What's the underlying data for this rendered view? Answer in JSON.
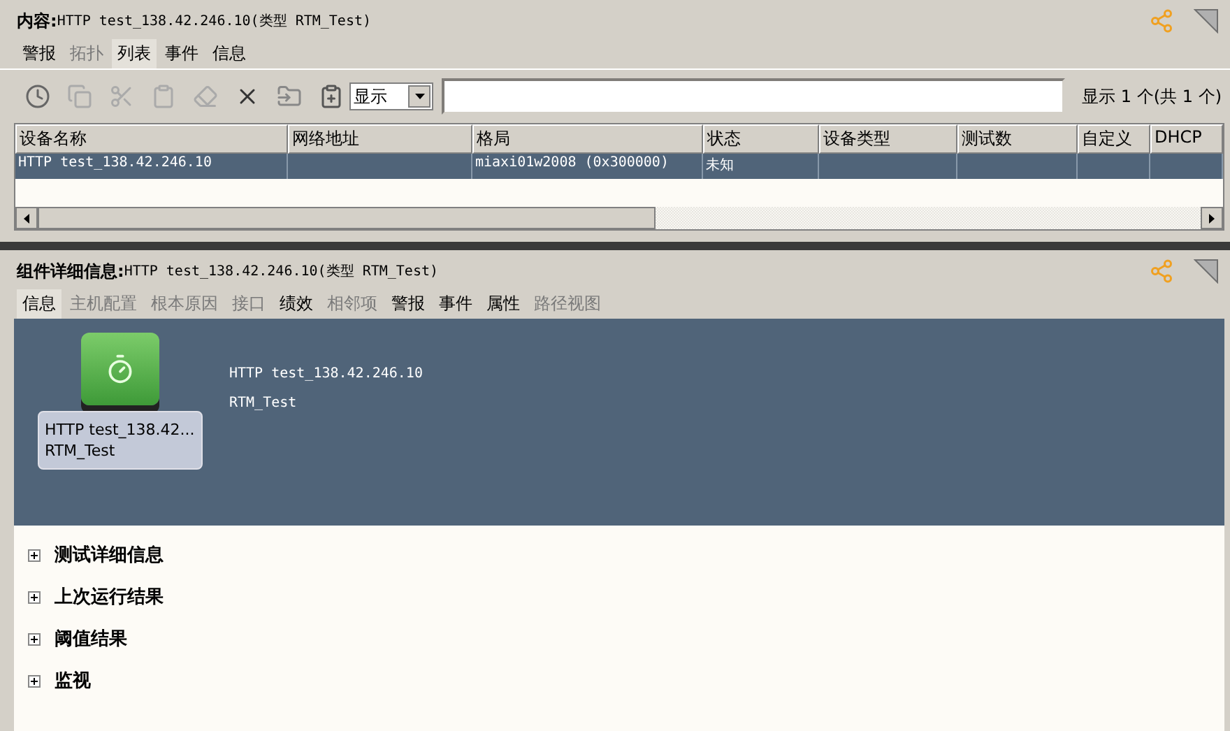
{
  "content_panel": {
    "label": "内容:",
    "value": "HTTP test_138.42.246.10(类型 RTM_Test)",
    "tabs": [
      {
        "label": "警报",
        "selected": false,
        "disabled": false
      },
      {
        "label": "拓扑",
        "selected": false,
        "disabled": true
      },
      {
        "label": "列表",
        "selected": true,
        "disabled": false
      },
      {
        "label": "事件",
        "selected": false,
        "disabled": false
      },
      {
        "label": "信息",
        "selected": false,
        "disabled": false
      }
    ],
    "toolbar": {
      "filter_dropdown": "显示",
      "count": "显示 1 个(共 1 个)"
    },
    "table": {
      "columns": [
        "设备名称",
        "网络地址",
        "格局",
        "状态",
        "设备类型",
        "测试数",
        "自定义",
        "DHCP"
      ],
      "rows": [
        {
          "selected": true,
          "cells": [
            "HTTP test_138.42.246.10",
            "",
            "miaxi01w2008 (0x300000)",
            "未知",
            "",
            "",
            "",
            ""
          ]
        }
      ]
    }
  },
  "details_panel": {
    "label": "组件详细信息:",
    "value": "HTTP test_138.42.246.10(类型 RTM_Test)",
    "tabs": [
      {
        "label": "信息",
        "selected": true,
        "disabled": false
      },
      {
        "label": "主机配置",
        "selected": false,
        "disabled": true
      },
      {
        "label": "根本原因",
        "selected": false,
        "disabled": true
      },
      {
        "label": "接口",
        "selected": false,
        "disabled": true
      },
      {
        "label": "绩效",
        "selected": false,
        "disabled": false
      },
      {
        "label": "相邻项",
        "selected": false,
        "disabled": true
      },
      {
        "label": "警报",
        "selected": false,
        "disabled": false
      },
      {
        "label": "事件",
        "selected": false,
        "disabled": false
      },
      {
        "label": "属性",
        "selected": false,
        "disabled": false
      },
      {
        "label": "路径视图",
        "selected": false,
        "disabled": true
      }
    ],
    "device": {
      "caption_lines": [
        "HTTP test_138.42...",
        "RTM_Test"
      ],
      "name": "HTTP test_138.42.246.10",
      "type": "RTM_Test"
    },
    "sections": [
      {
        "title": "测试详细信息",
        "expanded": false
      },
      {
        "title": "上次运行结果",
        "expanded": false
      },
      {
        "title": "阈值结果",
        "expanded": false
      },
      {
        "title": "监视",
        "expanded": false
      }
    ]
  }
}
